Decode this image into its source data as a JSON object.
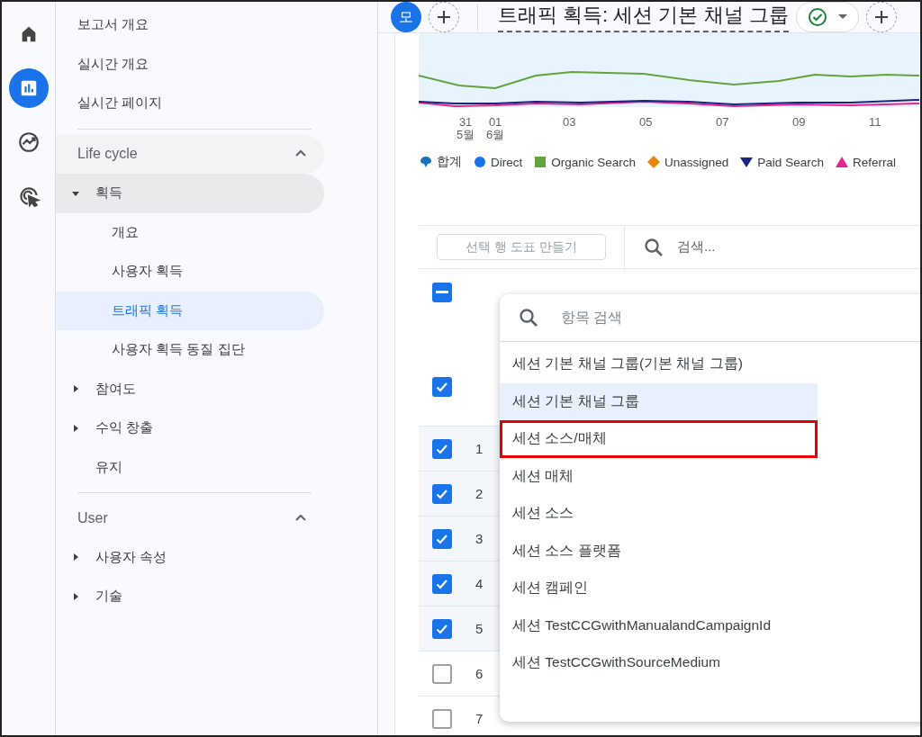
{
  "rail": [
    {
      "kind": "home",
      "selected": false
    },
    {
      "kind": "reports",
      "selected": true
    },
    {
      "kind": "explore",
      "selected": false
    },
    {
      "kind": "advertising",
      "selected": false
    }
  ],
  "sidebar": {
    "top_items": [
      "보고서 개요",
      "실시간 개요",
      "실시간 페이지"
    ],
    "sections": [
      {
        "title": "Life cycle",
        "expanded": true,
        "items": [
          {
            "label": "획득",
            "expanded": true,
            "has_children": true,
            "children": [
              {
                "label": "개요",
                "selected": false
              },
              {
                "label": "사용자 획득",
                "selected": false
              },
              {
                "label": "트래픽 획득",
                "selected": true
              },
              {
                "label": "사용자 획득 동질 집단",
                "selected": false
              }
            ]
          },
          {
            "label": "참여도",
            "expanded": false,
            "has_children": true
          },
          {
            "label": "수익 창출",
            "expanded": false,
            "has_children": true
          },
          {
            "label": "유지",
            "expanded": false,
            "has_children": false
          }
        ]
      },
      {
        "title": "User",
        "expanded": true,
        "items": [
          {
            "label": "사용자 속성",
            "expanded": false,
            "has_children": true
          },
          {
            "label": "기술",
            "expanded": false,
            "has_children": true
          }
        ]
      }
    ]
  },
  "topbar": {
    "avatar": "모",
    "title": "트래픽 획득: 세션 기본 채널 그룹"
  },
  "chart": {
    "x_labels": [
      {
        "day": "31",
        "month": "5월"
      },
      {
        "day": "01",
        "month": "6월"
      },
      {
        "day": "03"
      },
      {
        "day": "05"
      },
      {
        "day": "07"
      },
      {
        "day": "09"
      },
      {
        "day": "11"
      }
    ],
    "legend": [
      {
        "label": "합계",
        "kind": "bubble",
        "color": "#1a73b8"
      },
      {
        "label": "Direct",
        "kind": "circle",
        "color": "#1a73e8"
      },
      {
        "label": "Organic Search",
        "kind": "square",
        "color": "#62a33b"
      },
      {
        "label": "Unassigned",
        "kind": "diamond",
        "color": "#e8860c"
      },
      {
        "label": "Paid Search",
        "kind": "triangle-down",
        "color": "#1a237e"
      },
      {
        "label": "Referral",
        "kind": "triangle-up",
        "color": "#e52592"
      }
    ]
  },
  "toolbar": {
    "chart_button": "선택 행 도표 만들기",
    "search_placeholder": "검색..."
  },
  "table": {
    "select_all": {
      "indeterminate": true
    },
    "header_check": {
      "checked": true
    },
    "rows": [
      {
        "number": "1",
        "checked": true
      },
      {
        "number": "2",
        "checked": true
      },
      {
        "number": "3",
        "checked": true
      },
      {
        "number": "4",
        "checked": true
      },
      {
        "number": "5",
        "checked": true
      },
      {
        "number": "6",
        "checked": false
      },
      {
        "number": "7",
        "checked": false
      }
    ]
  },
  "dropdown": {
    "search_placeholder": "항목 검색",
    "items": [
      {
        "label": "세션 기본 채널 그룹(기본 채널 그룹)",
        "selected": false,
        "highlighted": false
      },
      {
        "label": "세션 기본 채널 그룹",
        "selected": true,
        "highlighted": false
      },
      {
        "label": "세션 소스/매체",
        "selected": false,
        "highlighted": true
      },
      {
        "label": "세션 매체",
        "selected": false,
        "highlighted": false
      },
      {
        "label": "세션 소스",
        "selected": false,
        "highlighted": false
      },
      {
        "label": "세션 소스 플랫폼",
        "selected": false,
        "highlighted": false
      },
      {
        "label": "세션 캠페인",
        "selected": false,
        "highlighted": false
      },
      {
        "label": "세션 TestCCGwithManualandCampaignId",
        "selected": false,
        "highlighted": false
      },
      {
        "label": "세션 TestCCGwithSourceMedium",
        "selected": false,
        "highlighted": false
      }
    ]
  }
}
